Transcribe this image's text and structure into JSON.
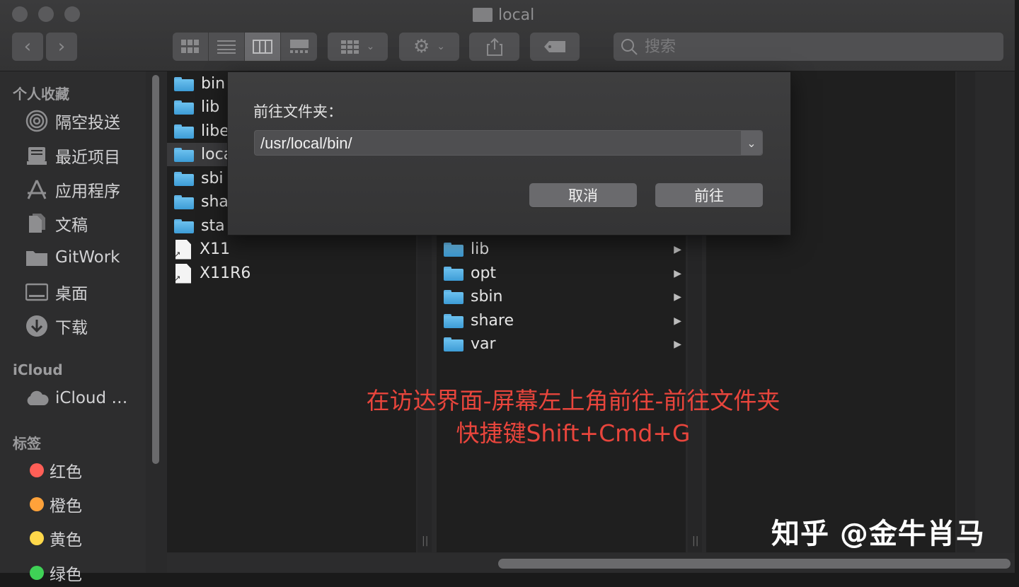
{
  "window": {
    "title": "local"
  },
  "toolbar": {
    "search_placeholder": "搜索"
  },
  "sidebar": {
    "sections": [
      {
        "title": "个人收藏"
      },
      {
        "title": "iCloud"
      },
      {
        "title": "标签"
      }
    ],
    "favorites": [
      {
        "label": "隔空投送",
        "icon": "airdrop-icon"
      },
      {
        "label": "最近项目",
        "icon": "recents-icon"
      },
      {
        "label": "应用程序",
        "icon": "applications-icon"
      },
      {
        "label": "文稿",
        "icon": "documents-icon"
      },
      {
        "label": "GitWork",
        "icon": "folder-icon"
      },
      {
        "label": "桌面",
        "icon": "desktop-icon"
      },
      {
        "label": "下载",
        "icon": "download-icon"
      }
    ],
    "icloud": [
      {
        "label": "iCloud …",
        "icon": "cloud-icon"
      }
    ],
    "tags": [
      {
        "label": "红色",
        "color": "#ff5f57"
      },
      {
        "label": "橙色",
        "color": "#ffa23a"
      },
      {
        "label": "黄色",
        "color": "#ffd84a"
      },
      {
        "label": "绿色",
        "color": "#3fd156"
      }
    ]
  },
  "column1": {
    "items": [
      {
        "name": "bin",
        "type": "folder"
      },
      {
        "name": "lib",
        "type": "folder"
      },
      {
        "name": "libe",
        "type": "folder"
      },
      {
        "name": "loca",
        "type": "folder",
        "selected": true
      },
      {
        "name": "sbi",
        "type": "folder"
      },
      {
        "name": "sha",
        "type": "folder"
      },
      {
        "name": "sta",
        "type": "folder"
      },
      {
        "name": "X11",
        "type": "alias"
      },
      {
        "name": "X11R6",
        "type": "alias"
      }
    ]
  },
  "column2": {
    "items": [
      {
        "name": "lib"
      },
      {
        "name": "opt"
      },
      {
        "name": "sbin"
      },
      {
        "name": "share"
      },
      {
        "name": "var"
      }
    ]
  },
  "dialog": {
    "label": "前往文件夹：",
    "path_value": "/usr/local/bin/",
    "cancel_label": "取消",
    "go_label": "前往"
  },
  "annotation": {
    "line1": "在访达界面-屏幕左上角前往-前往文件夹",
    "line2": "快捷键Shift+Cmd+G"
  },
  "watermark": "知乎 @金牛肖马",
  "colors": {
    "annotation": "#e8453c",
    "folder": "#5fb4e6"
  }
}
